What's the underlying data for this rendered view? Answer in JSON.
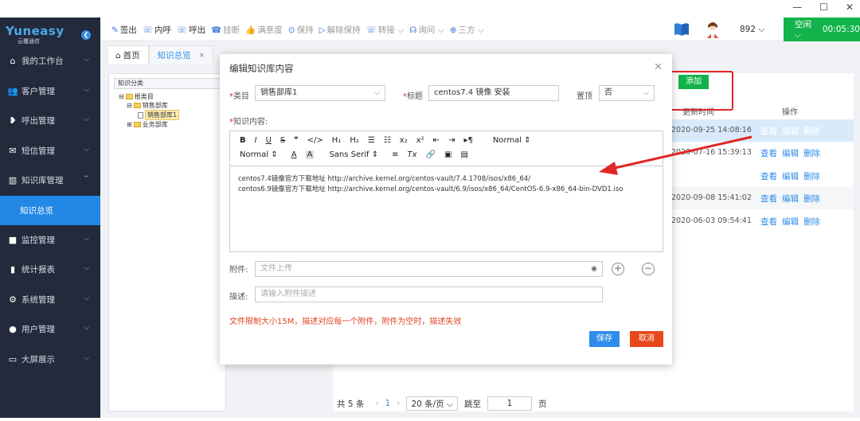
{
  "window": {
    "controls": [
      "—",
      "☐",
      "✕"
    ]
  },
  "sidebar": {
    "brand": "Yuneasy",
    "brand_sub": "云覆通信",
    "items": [
      {
        "label": "我的工作台",
        "icon": "home-icon"
      },
      {
        "label": "客户管理",
        "icon": "users-icon"
      },
      {
        "label": "呼出管理",
        "icon": "phone-out-icon"
      },
      {
        "label": "短信管理",
        "icon": "mail-icon"
      },
      {
        "label": "知识库管理",
        "icon": "book-icon",
        "expanded": true
      },
      {
        "label": "监控管理",
        "icon": "video-icon"
      },
      {
        "label": "统计报表",
        "icon": "bar-chart-icon"
      },
      {
        "label": "系统管理",
        "icon": "gear-icon"
      },
      {
        "label": "用户管理",
        "icon": "user-icon"
      },
      {
        "label": "大屏展示",
        "icon": "monitor-icon"
      }
    ],
    "sub_item": "知识总览"
  },
  "toolbar": {
    "items": [
      {
        "label": "签出",
        "icon": "✎",
        "disabled": false
      },
      {
        "label": "内呼",
        "icon": "☏",
        "disabled": false
      },
      {
        "label": "呼出",
        "icon": "☏",
        "disabled": false
      },
      {
        "label": "挂断",
        "icon": "☎",
        "disabled": true
      },
      {
        "label": "满意度",
        "icon": "👍",
        "disabled": true
      },
      {
        "label": "保持",
        "icon": "⊙",
        "disabled": true
      },
      {
        "label": "解除保持",
        "icon": "▷",
        "disabled": true
      },
      {
        "label": "转接 ⌵",
        "icon": "☏",
        "disabled": true
      },
      {
        "label": "询问 ⌵",
        "icon": "☊",
        "disabled": true
      },
      {
        "label": "三方 ⌵",
        "icon": "⊕",
        "disabled": true
      }
    ],
    "extension": "892 ⌵",
    "status": "空闲 ⌵",
    "timer": "00:05:30"
  },
  "tabs": [
    {
      "label": "首页",
      "icon": "⌂"
    },
    {
      "label": "知识总览",
      "close": "×"
    }
  ],
  "tree": {
    "header": "知识分类",
    "nodes": [
      {
        "label": "根类目",
        "level": 0,
        "toggle": "⊟"
      },
      {
        "label": "销售部库",
        "level": 1,
        "toggle": "⊟"
      },
      {
        "label": "销售部库1",
        "level": 2,
        "toggle": ""
      },
      {
        "label": "业务部库",
        "level": 1,
        "toggle": "⊞"
      }
    ]
  },
  "list": {
    "add_label": "添加",
    "col_time": "更新时间",
    "col_ops": "操作",
    "rows": [
      {
        "time": "2020-09-25 14:08:16",
        "highlight": true
      },
      {
        "time": "2020-07-16 15:39:13",
        "highlight": false
      },
      {
        "time": "",
        "highlight": false
      },
      {
        "time": "2020-09-08 15:41:02",
        "highlight": false
      },
      {
        "time": "2020-06-03 09:54:41",
        "highlight": false
      }
    ],
    "op_view": "查看",
    "op_edit": "编辑",
    "op_delete": "删除"
  },
  "pager": {
    "total": "共 5 条",
    "prev": "‹",
    "page": "1",
    "next": "›",
    "per_page": "20 条/页 ⌵",
    "goto_label": "跳至",
    "goto_value": "1",
    "page_unit": "页"
  },
  "modal": {
    "title": "编辑知识库内容",
    "close": "✕",
    "category_label": "类目",
    "category_value": "销售部库1",
    "title_label": "标题",
    "title_value": "centos7.4 镜像 安装",
    "top_label": "置顶",
    "top_value": "否",
    "content_label": "知识内容:",
    "toolbar_row1": [
      "B",
      "I",
      "U",
      "S",
      "❞",
      "</>",
      "H₁",
      "H₂",
      "☰",
      "☷",
      "x₂",
      "x²",
      "⇤",
      "⇥",
      "▸¶",
      "Normal ⇕"
    ],
    "toolbar_row2": [
      "Normal ⇕",
      "A",
      "A",
      "Sans Serif ⇕",
      "≡",
      "Tx",
      "🔗",
      "▣",
      "▤"
    ],
    "content_line1": "centos7.4镜像官方下载地址 http://archive.kernel.org/centos-vault/7.4.1708/isos/x86_64/",
    "content_line2": "centos6.9镜像官方下载地址 http://archive.kernel.org/centos-vault/6.9/isos/x86_64/CentOS-6.9-x86_64-bin-DVD1.iso",
    "attach_label": "附件:",
    "attach_placeholder": "文件上传",
    "desc_label": "描述:",
    "desc_placeholder": "请输入附件描述",
    "warning": "文件限制大小15M，描述对应每一个附件，附件为空时，描述失效",
    "save": "保存",
    "cancel": "取消"
  },
  "colors": {
    "sidebar_bg": "#232a3b",
    "accent_blue": "#2288e6",
    "green": "#11b34a",
    "red": "#e02626"
  }
}
